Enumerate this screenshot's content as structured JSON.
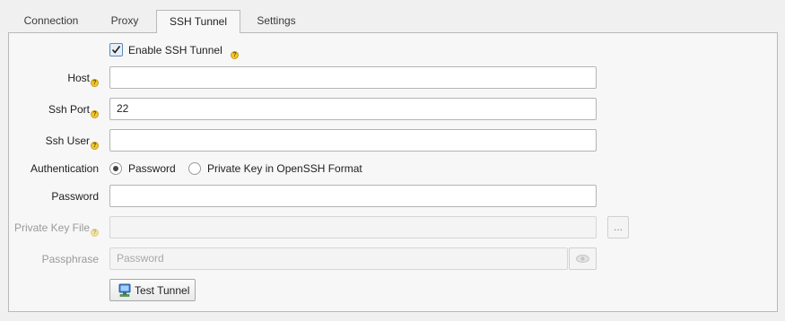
{
  "tabs": [
    {
      "label": "Connection"
    },
    {
      "label": "Proxy"
    },
    {
      "label": "SSH Tunnel"
    },
    {
      "label": "Settings"
    }
  ],
  "active_tab": "SSH Tunnel",
  "enable_ssh": {
    "label": "Enable SSH Tunnel",
    "checked": true
  },
  "fields": {
    "host": {
      "label": "Host",
      "value": ""
    },
    "ssh_port": {
      "label": "Ssh Port",
      "value": "22"
    },
    "ssh_user": {
      "label": "Ssh User",
      "value": ""
    },
    "authentication": {
      "label": "Authentication",
      "options": [
        "Password",
        "Private Key in OpenSSH Format"
      ],
      "selected": "Password"
    },
    "password": {
      "label": "Password",
      "value": ""
    },
    "private_key_file": {
      "label": "Private Key File",
      "value": "",
      "browse_label": "..."
    },
    "passphrase": {
      "label": "Passphrase",
      "placeholder": "Password"
    }
  },
  "help_glyph": "?",
  "test_button": {
    "label": "Test Tunnel",
    "icon": "computer-network-icon"
  },
  "colors": {
    "help_badge": "#f2c830",
    "checkbox_accent": "#5e88b8"
  }
}
